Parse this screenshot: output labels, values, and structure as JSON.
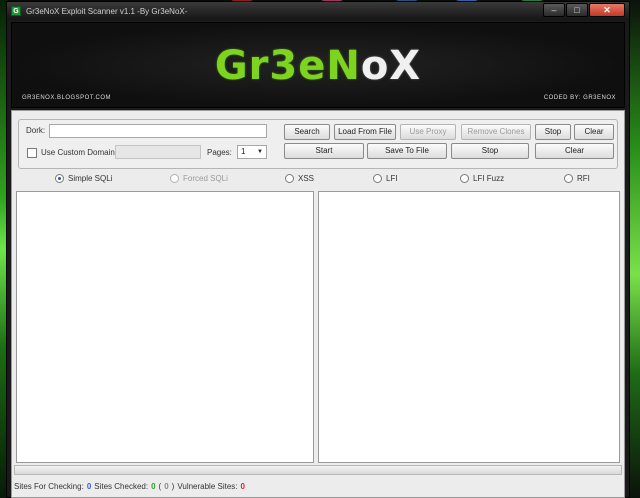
{
  "window": {
    "title": "Gr3eNoX Exploit Scanner v1.1 -By Gr3eNoX-",
    "app_icon_glyph": "G",
    "minimize_glyph": "–",
    "maximize_glyph": "□",
    "close_glyph": "✕"
  },
  "banner": {
    "logo_part1": "Gr3eN",
    "logo_part2": "oX",
    "blog": "GR3ENOX.BLOGSPOT.COM",
    "coded_by": "CODED BY: GR3ENOX",
    "colors": {
      "green": "#7ed321",
      "white": "#f0f0f0",
      "background": "#111111"
    }
  },
  "controls": {
    "dork_label": "Dork:",
    "dork_value": "",
    "custom_domain_label": "Use Custom Domain:",
    "custom_domain_checked": false,
    "custom_domain_value": "",
    "pages_label": "Pages:",
    "pages_value": "1",
    "buttons": {
      "search": "Search",
      "load_from_file": "Load From File",
      "use_proxy": "Use Proxy",
      "remove_clones": "Remove Clones",
      "stop_top": "Stop",
      "clear_top": "Clear",
      "start": "Start",
      "save_to_file": "Save To File",
      "stop_bottom": "Stop",
      "clear_bottom": "Clear"
    }
  },
  "scan_modes": [
    {
      "label": "Simple SQLi",
      "selected": true,
      "enabled": true
    },
    {
      "label": "Forced SQLi",
      "selected": false,
      "enabled": false
    },
    {
      "label": "XSS",
      "selected": false,
      "enabled": true
    },
    {
      "label": "LFI",
      "selected": false,
      "enabled": true
    },
    {
      "label": "LFI Fuzz",
      "selected": false,
      "enabled": true
    },
    {
      "label": "RFI",
      "selected": false,
      "enabled": true
    }
  ],
  "progress": 0,
  "status": {
    "sites_for_checking_label": "Sites For Checking:",
    "sites_for_checking_value": "0",
    "sites_checked_label": "Sites Checked:",
    "sites_checked_value": "0",
    "paren_open": "(",
    "sites_checked_extra": "0",
    "paren_close": ")",
    "vulnerable_label": "Vulnerable Sites:",
    "vulnerable_value": "0"
  }
}
